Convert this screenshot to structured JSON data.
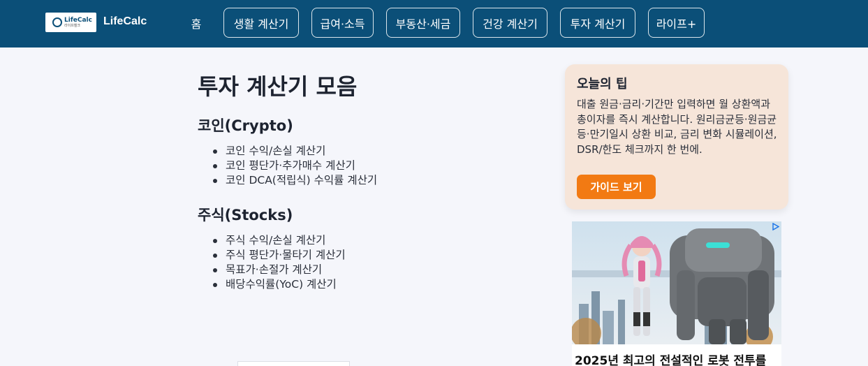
{
  "header": {
    "logo": {
      "line1": "LifeCalc",
      "line2": "라이프캘크"
    },
    "brand": "LifeCalc",
    "nav": [
      {
        "label": "홈"
      },
      {
        "label": "생활 계산기"
      },
      {
        "label": "급여·소득"
      },
      {
        "label": "부동산·세금"
      },
      {
        "label": "건강 계산기"
      },
      {
        "label": "투자 계산기"
      },
      {
        "label": "라이프+"
      }
    ]
  },
  "main": {
    "title": "투자 계산기 모음",
    "sections": [
      {
        "title": "코인(Crypto)",
        "items": [
          {
            "label": "코인 수익/손실 계산기"
          },
          {
            "label": "코인 평단가·추가매수 계산기"
          },
          {
            "label": "코인 DCA(적립식) 수익률 계산기"
          }
        ]
      },
      {
        "title": "주식(Stocks)",
        "items": [
          {
            "label": "주식 수익/손실 계산기"
          },
          {
            "label": "주식 평단가·물타기 계산기"
          },
          {
            "label": "목표가·손절가 계산기"
          },
          {
            "label": "배당수익률(YoC) 계산기"
          }
        ]
      }
    ]
  },
  "sidebar": {
    "tip": {
      "title": "오늘의 팁",
      "body": "대출 원금·금리·기간만 입력하면 월 상환액과 총이자를 즉시 계산합니다. 원리금균등·원금균등·만기일시 상환 비교, 금리 변화 시뮬레이션, DSR/한도 체크까지 한 번에.",
      "button": "가이드 보기"
    },
    "ad": {
      "caption": "2025년 최고의 전설적인 로봇 전투를",
      "choice_icon": "adchoices-icon"
    }
  },
  "colors": {
    "header_bg": "#0b4f78",
    "page_bg": "#f5f6fb",
    "tip_bg": "#f6e5d9",
    "accent": "#f27a13"
  }
}
